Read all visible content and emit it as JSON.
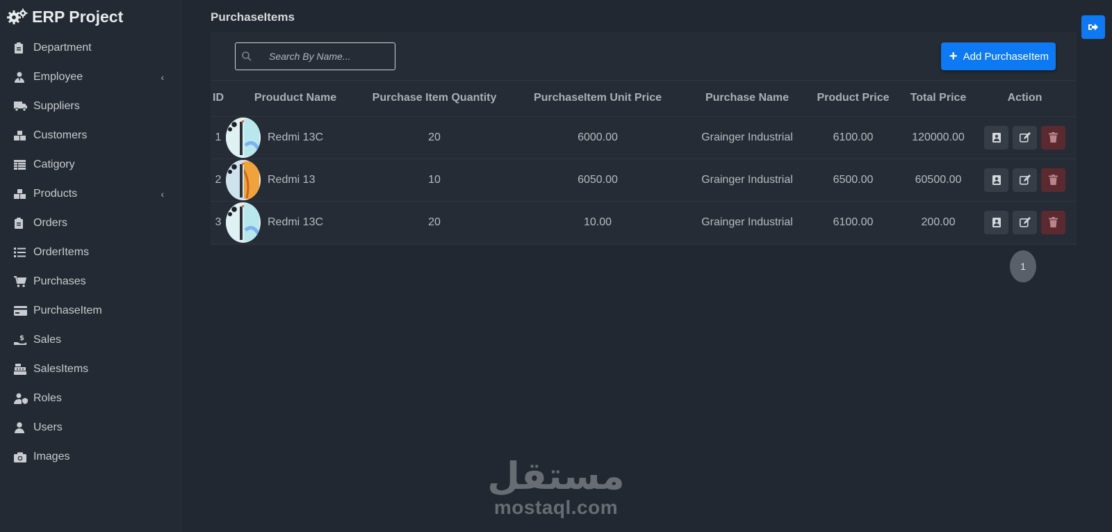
{
  "app": {
    "title": "ERP Project"
  },
  "sidebar": {
    "items": [
      {
        "label": "Department",
        "icon": "clipboard-icon",
        "chevron": false
      },
      {
        "label": "Employee",
        "icon": "user-tie-icon",
        "chevron": true
      },
      {
        "label": "Suppliers",
        "icon": "truck-icon",
        "chevron": false
      },
      {
        "label": "Customers",
        "icon": "boxes-icon",
        "chevron": false
      },
      {
        "label": "Catigory",
        "icon": "table-icon",
        "chevron": false
      },
      {
        "label": "Products",
        "icon": "boxes-icon",
        "chevron": true
      },
      {
        "label": "Orders",
        "icon": "clipboard-icon",
        "chevron": false
      },
      {
        "label": "OrderItems",
        "icon": "list-icon",
        "chevron": false
      },
      {
        "label": "Purchases",
        "icon": "cart-icon",
        "chevron": false
      },
      {
        "label": "PurchaseItem",
        "icon": "credit-card-icon",
        "chevron": false
      },
      {
        "label": "Sales",
        "icon": "hand-dollar-icon",
        "chevron": false
      },
      {
        "label": "SalesItems",
        "icon": "cash-register-icon",
        "chevron": false
      },
      {
        "label": "Roles",
        "icon": "user-shield-icon",
        "chevron": false
      },
      {
        "label": "Users",
        "icon": "user-icon",
        "chevron": false
      },
      {
        "label": "Images",
        "icon": "camera-icon",
        "chevron": false
      }
    ],
    "chevron_glyph": "‹"
  },
  "page": {
    "title": "PurchaseItems"
  },
  "search": {
    "placeholder": "Search By Name...",
    "value": ""
  },
  "add_button": {
    "label": "Add PurchaseItem"
  },
  "table": {
    "headers": {
      "id": "ID",
      "product": "Prouduct Name",
      "qty": "Purchase Item Quantity",
      "unit": "PurchaseItem Unit Price",
      "purchase": "Purchase Name",
      "pprice": "Product Price",
      "total": "Total Price",
      "action": "Action"
    },
    "rows": [
      {
        "id": "1",
        "product": "Redmi 13C",
        "qty": "20",
        "unit": "6000.00",
        "purchase": "Grainger Industrial",
        "pprice": "6100.00",
        "total": "120000.00",
        "image": "phone-teal"
      },
      {
        "id": "2",
        "product": "Redmi 13",
        "qty": "10",
        "unit": "6050.00",
        "purchase": "Grainger Industrial",
        "pprice": "6500.00",
        "total": "60500.00",
        "image": "phone-orange"
      },
      {
        "id": "3",
        "product": "Redmi 13C",
        "qty": "20",
        "unit": "10.00",
        "purchase": "Grainger Industrial",
        "pprice": "6100.00",
        "total": "200.00",
        "image": "phone-teal"
      }
    ]
  },
  "pagination": {
    "current": "1"
  },
  "watermark": {
    "arabic": "مستقل",
    "latin": "mostaql.com"
  },
  "colors": {
    "accent": "#0d7af3",
    "background": "#222831",
    "sidebar": "#232a33",
    "delete": "#5a2a30"
  }
}
